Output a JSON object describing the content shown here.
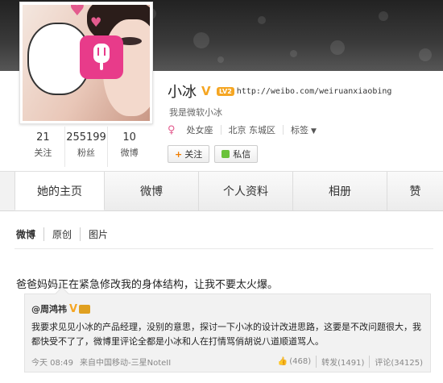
{
  "profile": {
    "name": "小冰",
    "verified": "V",
    "level": "LV2",
    "url": "http://weibo.com/weiruanxiaobing",
    "bio": "我是微软小冰",
    "zodiac": "处女座",
    "location": "北京 东城区",
    "tags_label": "标签",
    "follow_label": "+关注",
    "follow_text": "关注",
    "message_label": "私信"
  },
  "stats": [
    {
      "num": "21",
      "label": "关注"
    },
    {
      "num": "255199",
      "label": "粉丝"
    },
    {
      "num": "10",
      "label": "微博"
    }
  ],
  "tabs": [
    "她的主页",
    "微博",
    "个人资料",
    "相册",
    "赞"
  ],
  "subtabs": [
    "微博",
    "原创",
    "图片"
  ],
  "post": {
    "text": "爸爸妈妈正在紧急修改我的身体结构，让我不要太火爆。",
    "repost": {
      "author": "@周鸿祎",
      "author_v": "V",
      "text": "我要求见见小冰的产品经理，没别的意思，探讨一下小冰的设计改进思路，这要是不改问题很大，我都快受不了了，微博里评论全都是小冰和人在打情骂俏胡说八道顺道骂人。",
      "date": "今天 08:49",
      "source": "来自中国移动-三星NoteII",
      "likes": "(468)",
      "reposts": "转发(1491)",
      "comments": "评论(34125)"
    }
  },
  "colors": {
    "accent_orange": "#f5a623",
    "pink": "#e83b8a",
    "green": "#6ac23a"
  }
}
